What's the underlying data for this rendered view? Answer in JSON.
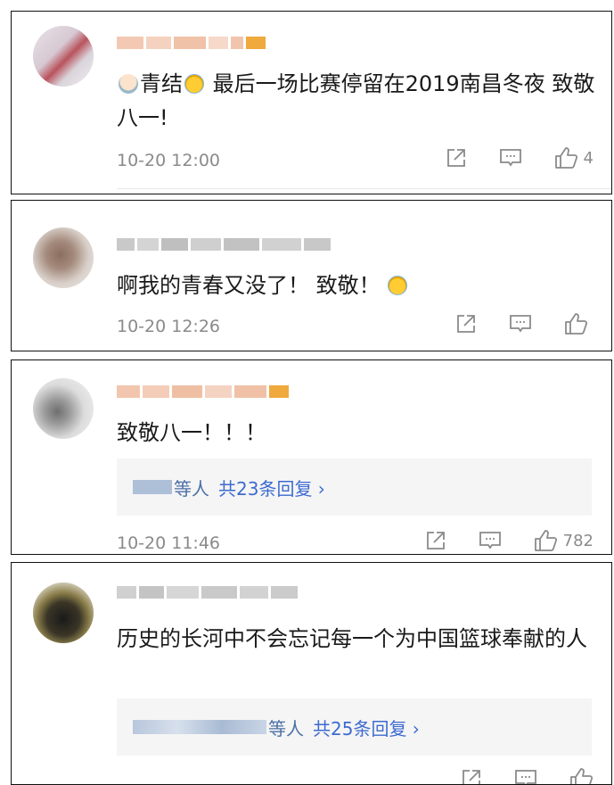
{
  "comments": [
    {
      "text_before_emoji": "青结",
      "text_after_emoji": " 最后一场比赛停留在2019南昌冬夜 致敬八一!",
      "time": "10-20 12:00",
      "like_count": "4"
    },
    {
      "text": "啊我的青春又没了！ 致敬！",
      "time": "10-20 12:26",
      "like_count": ""
    },
    {
      "text": "致敬八一！！！",
      "reply_users": "等人",
      "reply_more": "共23条回复 ›",
      "time": "10-20 11:46",
      "like_count": "782"
    },
    {
      "text": "历史的长河中不会忘记每一个为中国篮球奉献的人",
      "reply_users": "等人",
      "reply_more": "共25条回复 ›"
    }
  ],
  "icons": {
    "share": "share-icon",
    "comment": "comment-icon",
    "like": "thumbs-up-icon"
  },
  "colors": {
    "link": "#3d6bd1",
    "meta": "#8a8a8a",
    "reply_bg": "#f5f5f5"
  }
}
